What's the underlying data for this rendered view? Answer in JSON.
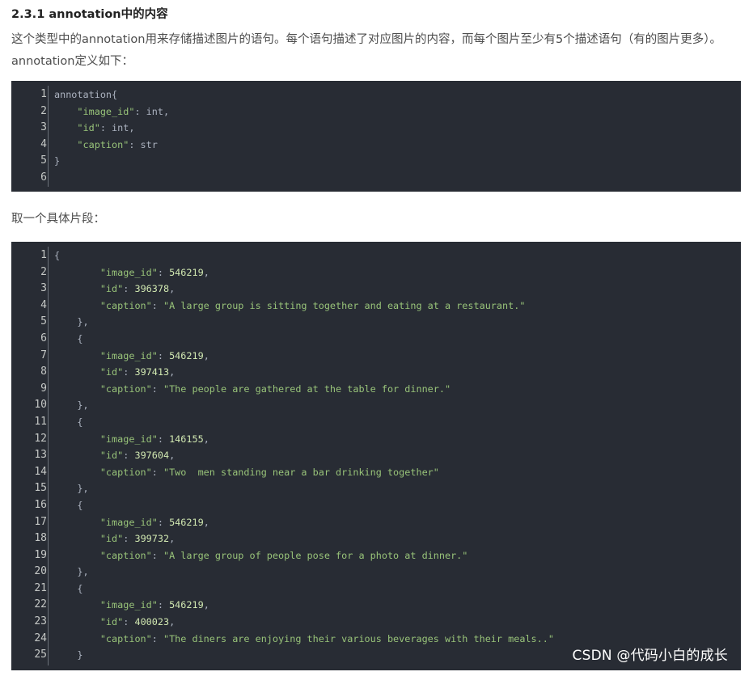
{
  "heading": "2.3.1 annotation中的内容",
  "paragraph": "这个类型中的annotation用来存储描述图片的语句。每个语句描述了对应图片的内容，而每个图片至少有5个描述语句（有的图片更多）。annotation定义如下：",
  "paragraph2": "取一个具体片段：",
  "code1": {
    "lines": [
      {
        "n": "1",
        "indent": "",
        "parts": [
          {
            "t": "annotation{",
            "c": "punc"
          }
        ]
      },
      {
        "n": "2",
        "indent": "    ",
        "parts": [
          {
            "t": "\"image_id\"",
            "c": "str"
          },
          {
            "t": ": int,",
            "c": "punc"
          }
        ]
      },
      {
        "n": "3",
        "indent": "    ",
        "parts": [
          {
            "t": "\"id\"",
            "c": "str"
          },
          {
            "t": ": int,",
            "c": "punc"
          }
        ]
      },
      {
        "n": "4",
        "indent": "    ",
        "parts": [
          {
            "t": "\"caption\"",
            "c": "str"
          },
          {
            "t": ": str",
            "c": "punc"
          }
        ]
      },
      {
        "n": "5",
        "indent": "",
        "parts": [
          {
            "t": "}",
            "c": "punc"
          }
        ]
      },
      {
        "n": "6",
        "indent": "",
        "parts": []
      }
    ]
  },
  "code2": {
    "lines": [
      {
        "n": "1",
        "indent": "",
        "parts": [
          {
            "t": "{",
            "c": "punc"
          }
        ]
      },
      {
        "n": "2",
        "indent": "        ",
        "parts": [
          {
            "t": "\"image_id\"",
            "c": "str"
          },
          {
            "t": ": ",
            "c": "punc"
          },
          {
            "t": "546219",
            "c": "num"
          },
          {
            "t": ",",
            "c": "punc"
          }
        ]
      },
      {
        "n": "3",
        "indent": "        ",
        "parts": [
          {
            "t": "\"id\"",
            "c": "str"
          },
          {
            "t": ": ",
            "c": "punc"
          },
          {
            "t": "396378",
            "c": "num"
          },
          {
            "t": ",",
            "c": "punc"
          }
        ]
      },
      {
        "n": "4",
        "indent": "        ",
        "parts": [
          {
            "t": "\"caption\"",
            "c": "str"
          },
          {
            "t": ": ",
            "c": "punc"
          },
          {
            "t": "\"A large group is sitting together and eating at a restaurant.\"",
            "c": "str"
          }
        ]
      },
      {
        "n": "5",
        "indent": "    ",
        "parts": [
          {
            "t": "},",
            "c": "punc"
          }
        ]
      },
      {
        "n": "6",
        "indent": "    ",
        "parts": [
          {
            "t": "{",
            "c": "punc"
          }
        ]
      },
      {
        "n": "7",
        "indent": "        ",
        "parts": [
          {
            "t": "\"image_id\"",
            "c": "str"
          },
          {
            "t": ": ",
            "c": "punc"
          },
          {
            "t": "546219",
            "c": "num"
          },
          {
            "t": ",",
            "c": "punc"
          }
        ]
      },
      {
        "n": "8",
        "indent": "        ",
        "parts": [
          {
            "t": "\"id\"",
            "c": "str"
          },
          {
            "t": ": ",
            "c": "punc"
          },
          {
            "t": "397413",
            "c": "num"
          },
          {
            "t": ",",
            "c": "punc"
          }
        ]
      },
      {
        "n": "9",
        "indent": "        ",
        "parts": [
          {
            "t": "\"caption\"",
            "c": "str"
          },
          {
            "t": ": ",
            "c": "punc"
          },
          {
            "t": "\"The people are gathered at the table for dinner.\"",
            "c": "str"
          }
        ]
      },
      {
        "n": "10",
        "indent": "    ",
        "parts": [
          {
            "t": "},",
            "c": "punc"
          }
        ]
      },
      {
        "n": "11",
        "indent": "    ",
        "parts": [
          {
            "t": "{",
            "c": "punc"
          }
        ]
      },
      {
        "n": "12",
        "indent": "        ",
        "parts": [
          {
            "t": "\"image_id\"",
            "c": "str"
          },
          {
            "t": ": ",
            "c": "punc"
          },
          {
            "t": "146155",
            "c": "num"
          },
          {
            "t": ",",
            "c": "punc"
          }
        ]
      },
      {
        "n": "13",
        "indent": "        ",
        "parts": [
          {
            "t": "\"id\"",
            "c": "str"
          },
          {
            "t": ": ",
            "c": "punc"
          },
          {
            "t": "397604",
            "c": "num"
          },
          {
            "t": ",",
            "c": "punc"
          }
        ]
      },
      {
        "n": "14",
        "indent": "        ",
        "parts": [
          {
            "t": "\"caption\"",
            "c": "str"
          },
          {
            "t": ": ",
            "c": "punc"
          },
          {
            "t": "\"Two  men standing near a bar drinking together\"",
            "c": "str"
          }
        ]
      },
      {
        "n": "15",
        "indent": "    ",
        "parts": [
          {
            "t": "},",
            "c": "punc"
          }
        ]
      },
      {
        "n": "16",
        "indent": "    ",
        "parts": [
          {
            "t": "{",
            "c": "punc"
          }
        ]
      },
      {
        "n": "17",
        "indent": "        ",
        "parts": [
          {
            "t": "\"image_id\"",
            "c": "str"
          },
          {
            "t": ": ",
            "c": "punc"
          },
          {
            "t": "546219",
            "c": "num"
          },
          {
            "t": ",",
            "c": "punc"
          }
        ]
      },
      {
        "n": "18",
        "indent": "        ",
        "parts": [
          {
            "t": "\"id\"",
            "c": "str"
          },
          {
            "t": ": ",
            "c": "punc"
          },
          {
            "t": "399732",
            "c": "num"
          },
          {
            "t": ",",
            "c": "punc"
          }
        ]
      },
      {
        "n": "19",
        "indent": "        ",
        "parts": [
          {
            "t": "\"caption\"",
            "c": "str"
          },
          {
            "t": ": ",
            "c": "punc"
          },
          {
            "t": "\"A large group of people pose for a photo at dinner.\"",
            "c": "str"
          }
        ]
      },
      {
        "n": "20",
        "indent": "    ",
        "parts": [
          {
            "t": "},",
            "c": "punc"
          }
        ]
      },
      {
        "n": "21",
        "indent": "    ",
        "parts": [
          {
            "t": "{",
            "c": "punc"
          }
        ]
      },
      {
        "n": "22",
        "indent": "        ",
        "parts": [
          {
            "t": "\"image_id\"",
            "c": "str"
          },
          {
            "t": ": ",
            "c": "punc"
          },
          {
            "t": "546219",
            "c": "num"
          },
          {
            "t": ",",
            "c": "punc"
          }
        ]
      },
      {
        "n": "23",
        "indent": "        ",
        "parts": [
          {
            "t": "\"id\"",
            "c": "str"
          },
          {
            "t": ": ",
            "c": "punc"
          },
          {
            "t": "400023",
            "c": "num"
          },
          {
            "t": ",",
            "c": "punc"
          }
        ]
      },
      {
        "n": "24",
        "indent": "        ",
        "parts": [
          {
            "t": "\"caption\"",
            "c": "str"
          },
          {
            "t": ": ",
            "c": "punc"
          },
          {
            "t": "\"The diners are enjoying their various beverages with their meals..\"",
            "c": "str"
          }
        ]
      },
      {
        "n": "25",
        "indent": "    ",
        "parts": [
          {
            "t": "}",
            "c": "punc"
          }
        ]
      }
    ]
  },
  "watermark": "CSDN @代码小白的成长"
}
